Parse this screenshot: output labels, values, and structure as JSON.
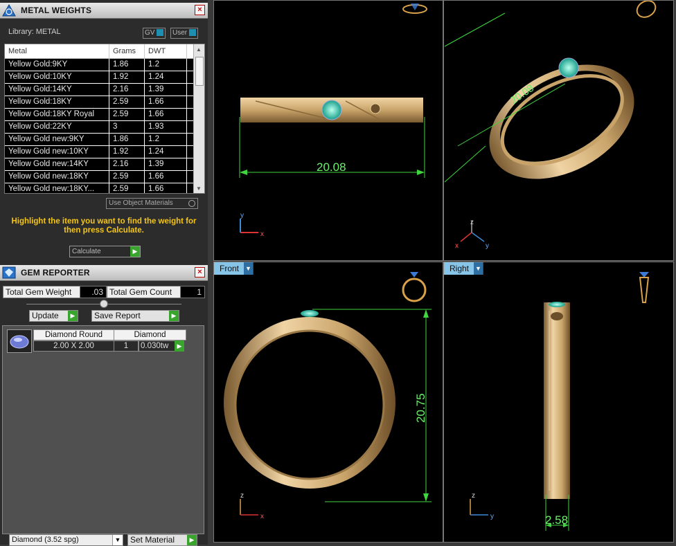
{
  "metal_panel": {
    "title": "METAL WEIGHTS",
    "library_label": "Library: METAL",
    "toggle_gv": "GV",
    "toggle_user": "User",
    "columns": [
      "Metal",
      "Grams",
      "DWT"
    ],
    "rows": [
      {
        "metal": "Yellow Gold:9KY",
        "grams": "1.86",
        "dwt": "1.2"
      },
      {
        "metal": "Yellow Gold:10KY",
        "grams": "1.92",
        "dwt": "1.24"
      },
      {
        "metal": "Yellow Gold:14KY",
        "grams": "2.16",
        "dwt": "1.39"
      },
      {
        "metal": "Yellow Gold:18KY",
        "grams": "2.59",
        "dwt": "1.66"
      },
      {
        "metal": "Yellow Gold:18KY Royal",
        "grams": "2.59",
        "dwt": "1.66"
      },
      {
        "metal": "Yellow Gold:22KY",
        "grams": "3",
        "dwt": "1.93"
      },
      {
        "metal": "Yellow Gold new:9KY",
        "grams": "1.86",
        "dwt": "1.2"
      },
      {
        "metal": "Yellow Gold new:10KY",
        "grams": "1.92",
        "dwt": "1.24"
      },
      {
        "metal": "Yellow Gold new:14KY",
        "grams": "2.16",
        "dwt": "1.39"
      },
      {
        "metal": "Yellow Gold new:18KY",
        "grams": "2.59",
        "dwt": "1.66"
      },
      {
        "metal": "Yellow Gold new:18KY...",
        "grams": "2.59",
        "dwt": "1.66"
      }
    ],
    "use_object_materials": "Use Object Materials",
    "hint": "Highlight the item you want to find the weight for then press Calculate.",
    "calculate": "Calculate"
  },
  "gem_panel": {
    "title": "GEM REPORTER",
    "total_weight_label": "Total Gem Weight",
    "total_weight": ".03",
    "total_count_label": "Total Gem Count",
    "total_count": "1",
    "update": "Update",
    "save_report": "Save Report",
    "gem": {
      "shape": "Diamond Round",
      "size": "2.00 X 2.00",
      "material": "Diamond",
      "count": "1",
      "weight": "0.030tw"
    }
  },
  "bottom": {
    "material_select": "Diamond    (3.52 spg)",
    "set_material": "Set Material"
  },
  "viewports": {
    "top": {
      "dimension": "20.08",
      "axis_v": "y",
      "axis_h": "x"
    },
    "perspective": {
      "dimension": "20.08",
      "axis_1": "z",
      "axis_2": "y",
      "axis_3": "x"
    },
    "front": {
      "label": "Front",
      "dimension": "20.75",
      "axis_v": "z",
      "axis_h": "x"
    },
    "right": {
      "label": "Right",
      "dimension": "2.58",
      "axis_v": "z",
      "axis_h": "y"
    }
  },
  "colors": {
    "accent": "#86c4e8",
    "gold": "#c9a46a",
    "dimension": "#6cf06c",
    "hint": "#f5c518"
  }
}
